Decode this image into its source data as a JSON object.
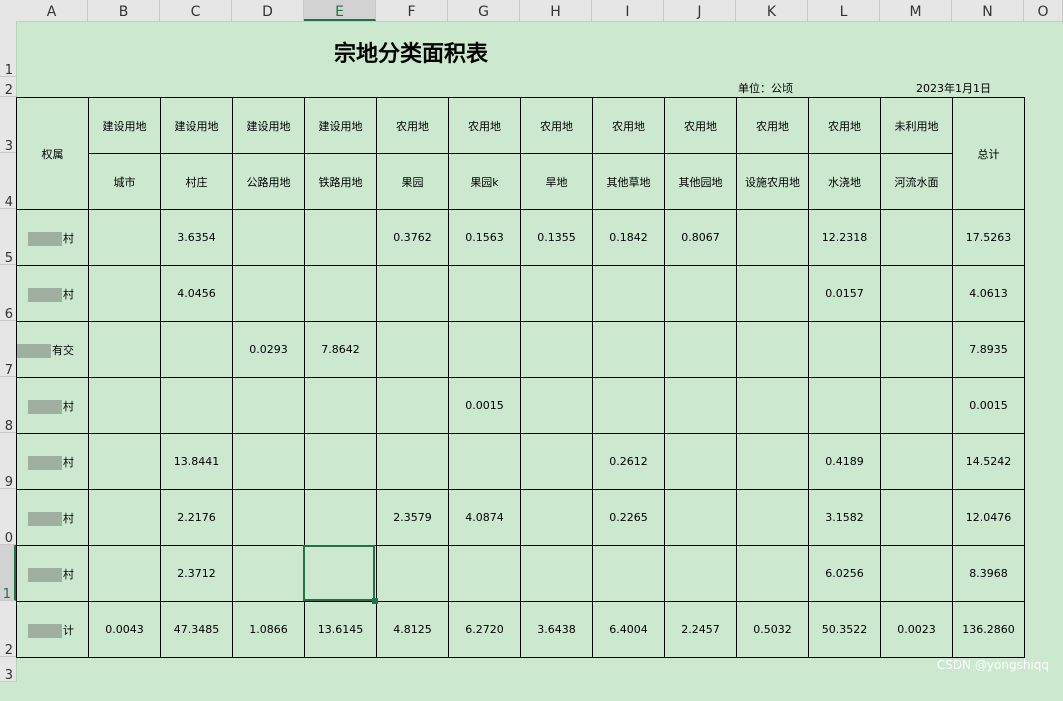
{
  "columns": [
    "A",
    "B",
    "C",
    "D",
    "E",
    "F",
    "G",
    "H",
    "I",
    "J",
    "K",
    "L",
    "M",
    "N",
    "O"
  ],
  "rows": [
    "1",
    "2",
    "3",
    "4",
    "5",
    "6",
    "7",
    "8",
    "9",
    "0",
    "1",
    "2",
    "3"
  ],
  "sheet": {
    "title": "宗地分类面积表",
    "unit": "单位：公顷",
    "date": "2023年1月1日",
    "rowLabelHeader": "权属",
    "totalHeader": "总计",
    "headerTop": [
      "建设用地",
      "建设用地",
      "建设用地",
      "建设用地",
      "农用地",
      "农用地",
      "农用地",
      "农用地",
      "农用地",
      "农用地",
      "农用地",
      "未利用地"
    ],
    "headerBottom": [
      "城市",
      "村庄",
      "公路用地",
      "铁路用地",
      "果园",
      "果园k",
      "旱地",
      "其他草地",
      "其他园地",
      "设施农用地",
      "水浇地",
      "河流水面"
    ],
    "rows": [
      {
        "label": "村",
        "values": [
          "",
          "3.6354",
          "",
          "",
          "0.3762",
          "0.1563",
          "0.1355",
          "0.1842",
          "0.8067",
          "",
          "12.2318",
          "",
          "17.5263"
        ]
      },
      {
        "label": "村",
        "values": [
          "",
          "4.0456",
          "",
          "",
          "",
          "",
          "",
          "",
          "",
          "",
          "0.0157",
          "",
          "4.0613"
        ]
      },
      {
        "label": "有交",
        "values": [
          "",
          "",
          "0.0293",
          "7.8642",
          "",
          "",
          "",
          "",
          "",
          "",
          "",
          "",
          "7.8935"
        ]
      },
      {
        "label": "村",
        "values": [
          "",
          "",
          "",
          "",
          "",
          "0.0015",
          "",
          "",
          "",
          "",
          "",
          "",
          "0.0015"
        ]
      },
      {
        "label": "村",
        "values": [
          "",
          "13.8441",
          "",
          "",
          "",
          "",
          "",
          "0.2612",
          "",
          "",
          "0.4189",
          "",
          "14.5242"
        ]
      },
      {
        "label": "村",
        "values": [
          "",
          "2.2176",
          "",
          "",
          "2.3579",
          "4.0874",
          "",
          "0.2265",
          "",
          "",
          "3.1582",
          "",
          "12.0476"
        ]
      },
      {
        "label": "村",
        "values": [
          "",
          "2.3712",
          "",
          "",
          "",
          "",
          "",
          "",
          "",
          "",
          "6.0256",
          "",
          "8.3968"
        ]
      },
      {
        "label": "计",
        "values": [
          "0.0043",
          "47.3485",
          "1.0866",
          "13.6145",
          "4.8125",
          "6.2720",
          "3.6438",
          "6.4004",
          "2.2457",
          "0.5032",
          "50.3522",
          "0.0023",
          "136.2860"
        ]
      }
    ]
  },
  "watermark": "CSDN @yongshiqq"
}
